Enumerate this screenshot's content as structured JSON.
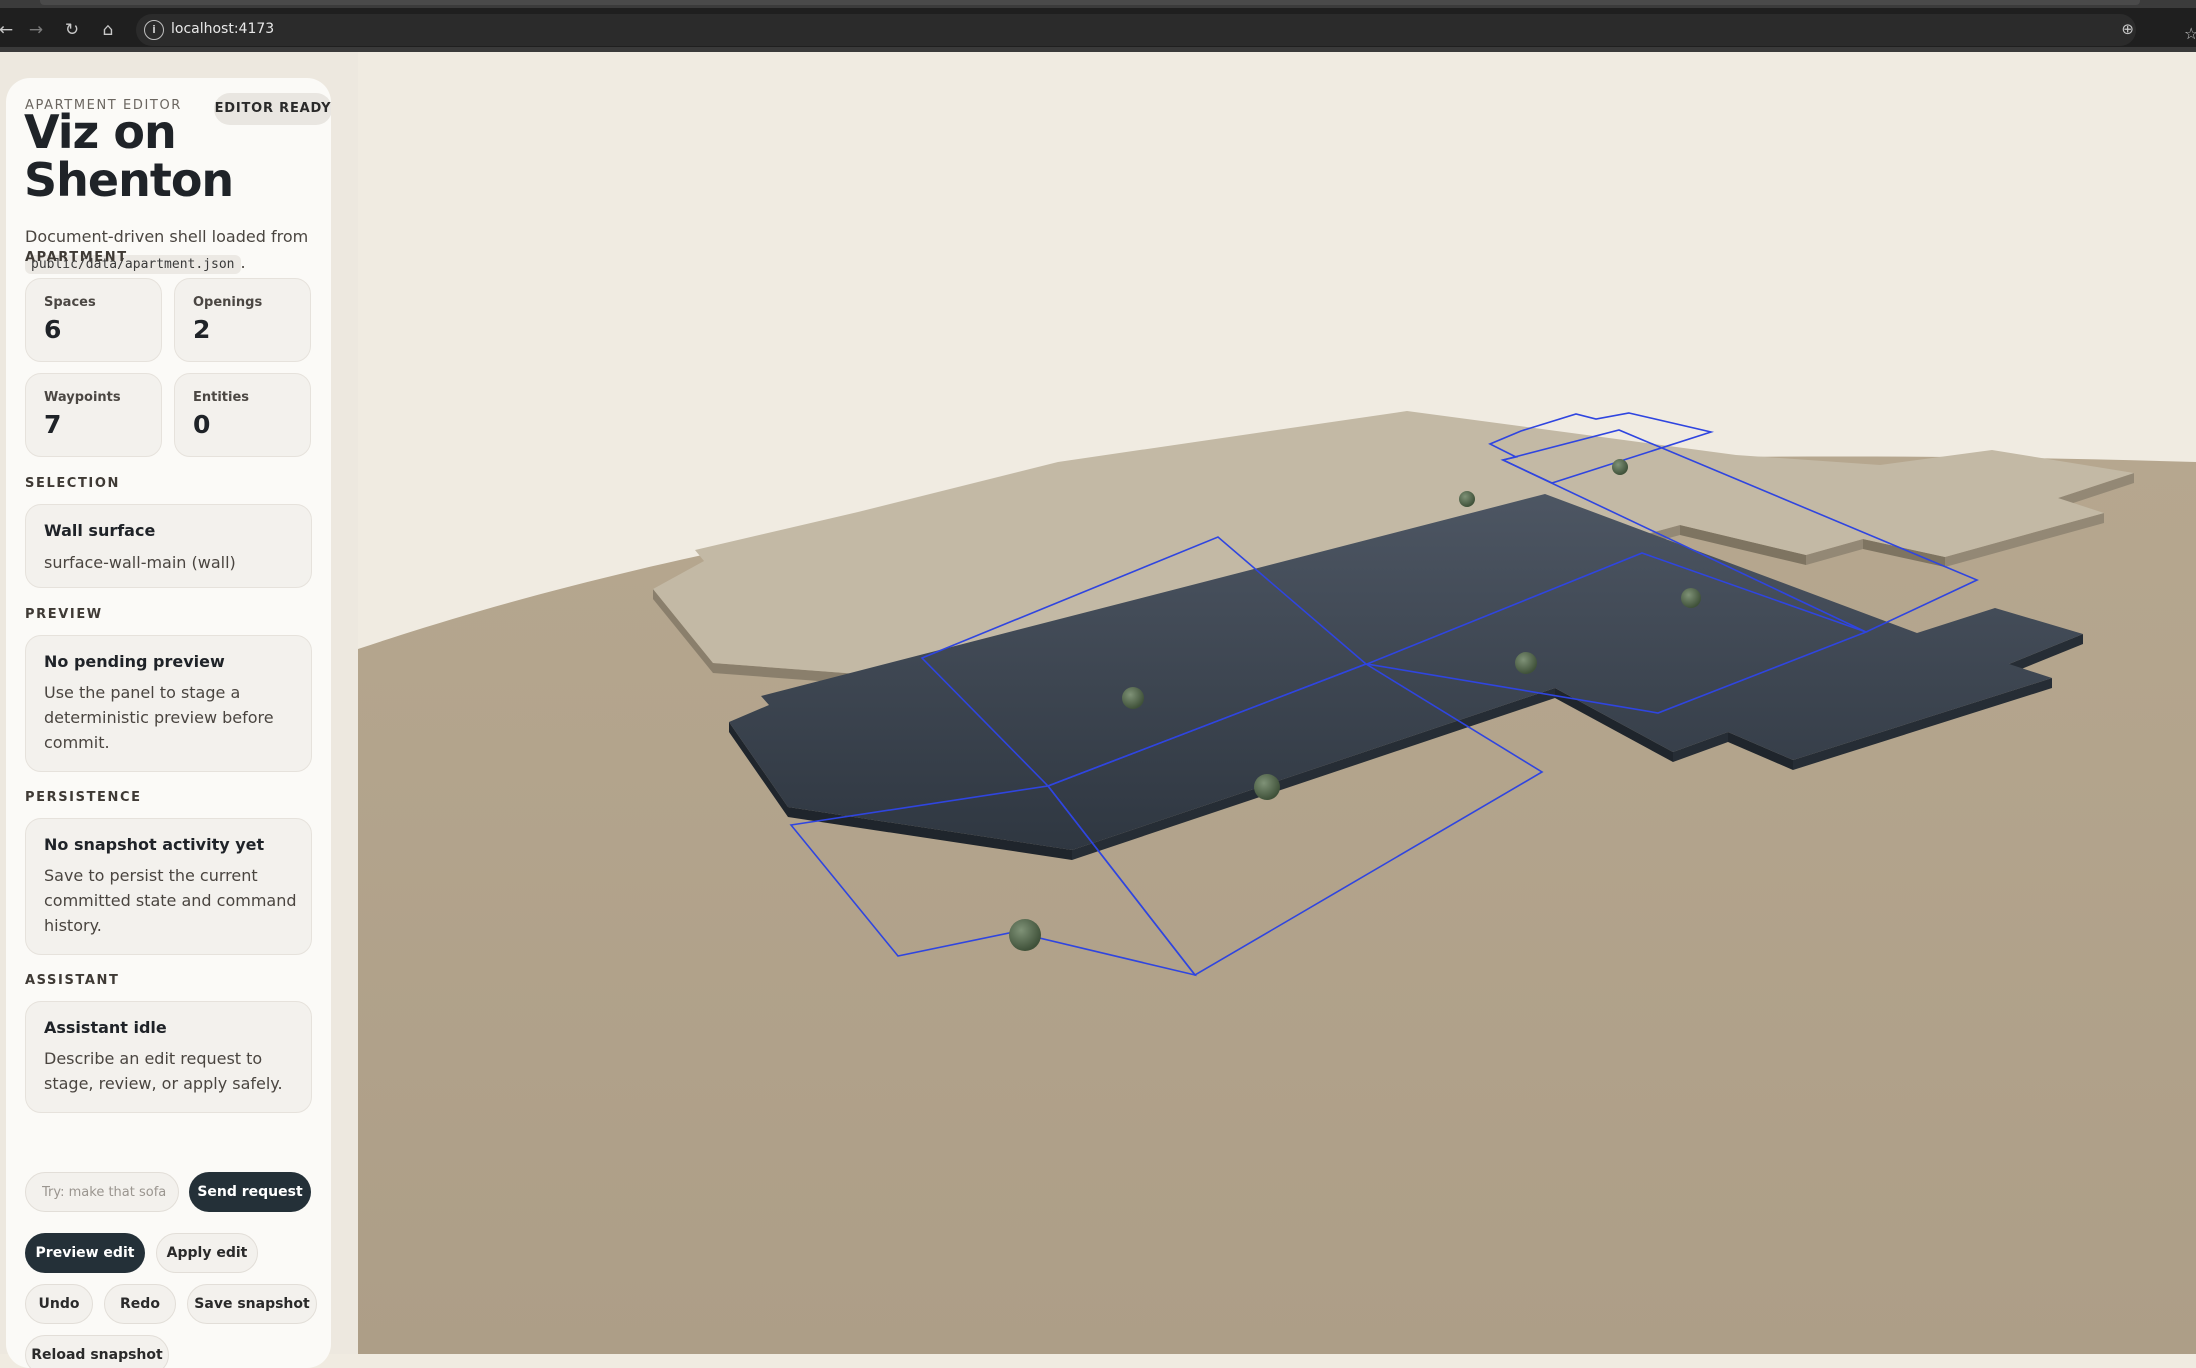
{
  "browser": {
    "url": "localhost:4173",
    "back_icon": "arrow-left-icon",
    "forward_icon": "arrow-right-icon",
    "reload_icon": "reload-icon",
    "home_icon": "home-icon",
    "site_info_icon": "info-circle-icon",
    "zoom_icon": "zoom-icon",
    "bookmark_icon": "star-icon"
  },
  "panel": {
    "eyebrow": "APARTMENT EDITOR",
    "status": "EDITOR READY",
    "title": "Viz on Shenton",
    "description_prefix": "Document-driven shell loaded from",
    "description_code": "public/data/apartment.json",
    "description_suffix": "."
  },
  "apartment": {
    "label": "APARTMENT",
    "stats": [
      {
        "label": "Spaces",
        "value": "6"
      },
      {
        "label": "Openings",
        "value": "2"
      },
      {
        "label": "Waypoints",
        "value": "7"
      },
      {
        "label": "Entities",
        "value": "0"
      }
    ]
  },
  "selection": {
    "label": "SELECTION",
    "title": "Wall surface",
    "detail": "surface-wall-main (wall)"
  },
  "preview": {
    "label": "PREVIEW",
    "title": "No pending preview",
    "body": "Use the panel to stage a deterministic preview before commit."
  },
  "persistence": {
    "label": "PERSISTENCE",
    "title": "No snapshot activity yet",
    "body": "Save to persist the current committed state and command history."
  },
  "assistant": {
    "label": "ASSISTANT",
    "title": "Assistant idle",
    "body": "Describe an edit request to stage, review, or apply safely.",
    "input_placeholder": "Try: make that sofa",
    "send_label": "Send request"
  },
  "actions": {
    "preview_edit": "Preview edit",
    "apply_edit": "Apply edit",
    "undo": "Undo",
    "redo": "Redo",
    "save_snapshot": "Save snapshot",
    "reload_snapshot": "Reload snapshot"
  },
  "colors": {
    "floor_plate": "#333c47",
    "upper_plate": "#c3b9a5",
    "ground": "#ad9e87",
    "sky": "#f0ebe1",
    "outline": "#2f45e0",
    "waypoint": "#53664d",
    "accent_dark": "#243038"
  }
}
